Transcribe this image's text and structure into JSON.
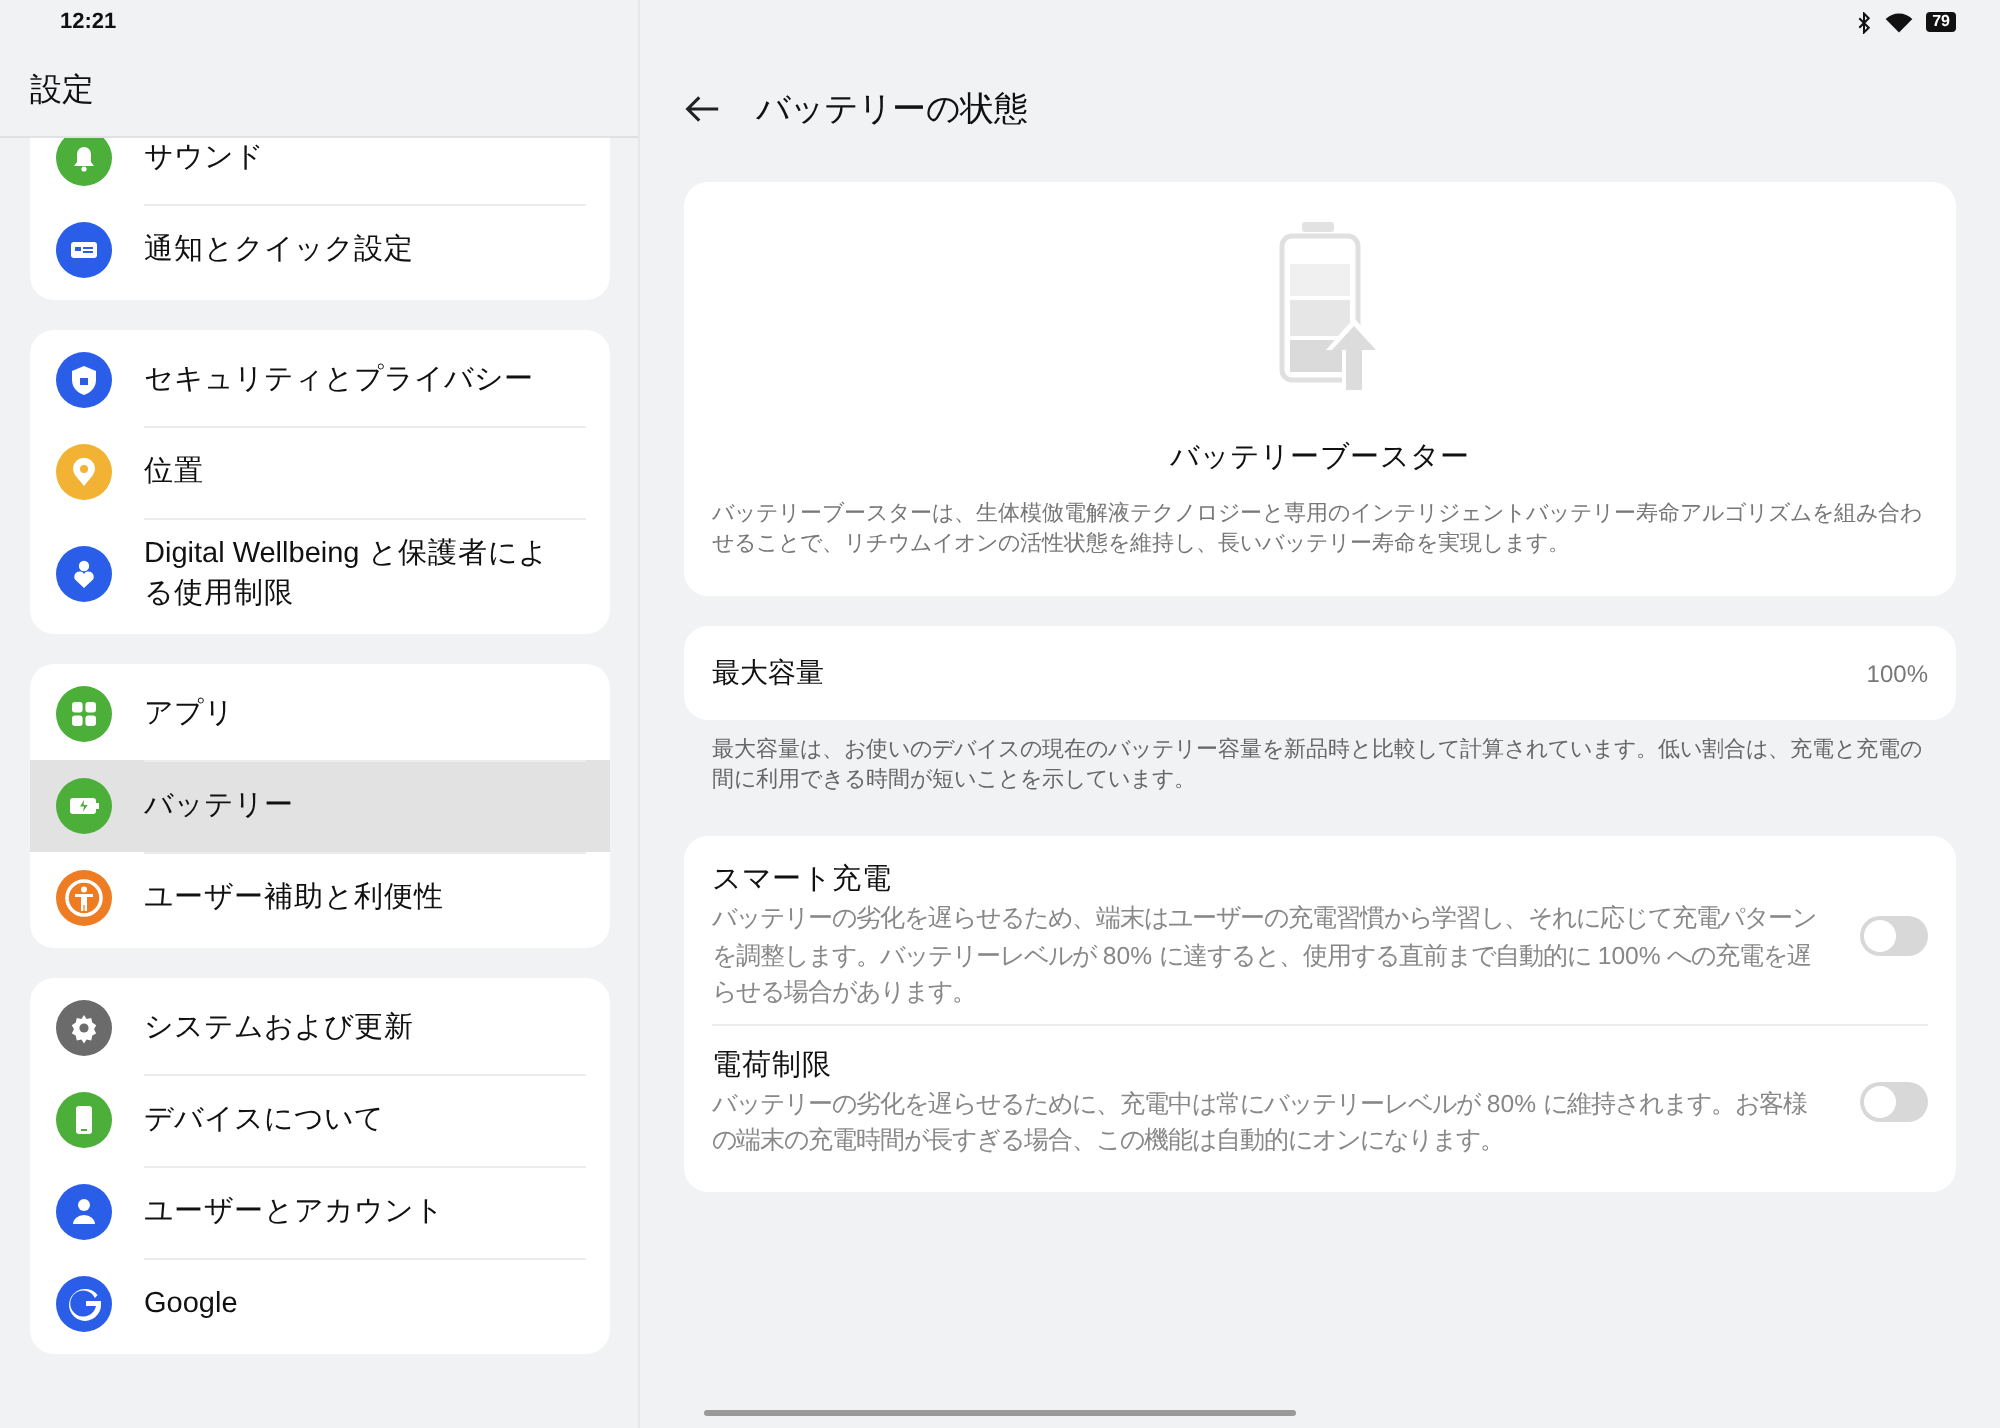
{
  "status_bar": {
    "time": "12:21",
    "battery": "79"
  },
  "sidebar": {
    "title": "設定",
    "groups": [
      {
        "items": [
          {
            "label": "サウンド",
            "color": "#4caf3a",
            "selected": false
          },
          {
            "label": "通知とクイック設定",
            "color": "#2a5ee8",
            "selected": false
          }
        ]
      },
      {
        "items": [
          {
            "label": "セキュリティとプライバシー",
            "color": "#2a5ee8",
            "selected": false
          },
          {
            "label": "位置",
            "color": "#f2b233",
            "selected": false
          },
          {
            "label": "Digital Wellbeing と保護者による使用制限",
            "color": "#2a5ee8",
            "selected": false
          }
        ]
      },
      {
        "items": [
          {
            "label": "アプリ",
            "color": "#4caf3a",
            "selected": false
          },
          {
            "label": "バッテリー",
            "color": "#4caf3a",
            "selected": true
          },
          {
            "label": "ユーザー補助と利便性",
            "color": "#ee7c22",
            "selected": false
          }
        ]
      },
      {
        "items": [
          {
            "label": "システムおよび更新",
            "color": "#6b6b6b",
            "selected": false
          },
          {
            "label": "デバイスについて",
            "color": "#4caf3a",
            "selected": false
          },
          {
            "label": "ユーザーとアカウント",
            "color": "#2a5ee8",
            "selected": false
          },
          {
            "label": "Google",
            "color": "#2a5ee8",
            "selected": false
          }
        ]
      }
    ]
  },
  "page": {
    "title": "バッテリーの状態",
    "booster": {
      "title": "バッテリーブースター",
      "description": "バッテリーブースターは、生体模倣電解液テクノロジーと専用のインテリジェントバッテリー寿命アルゴリズムを組み合わせることで、リチウムイオンの活性状態を維持し、長いバッテリー寿命を実現します。"
    },
    "capacity": {
      "label": "最大容量",
      "value": "100%",
      "note": "最大容量は、お使いのデバイスの現在のバッテリー容量を新品時と比較して計算されています。低い割合は、充電と充電の間に利用できる時間が短いことを示しています。"
    },
    "toggles": [
      {
        "title": "スマート充電",
        "description": "バッテリーの劣化を遅らせるため、端末はユーザーの充電習慣から学習し、それに応じて充電パターンを調整します。バッテリーレベルが 80% に達すると、使用する直前まで自動的に 100% への充電を遅らせる場合があります。",
        "on": false
      },
      {
        "title": "電荷制限",
        "description": "バッテリーの劣化を遅らせるために、充電中は常にバッテリーレベルが 80% に維持されます。お客様の端末の充電時間が長すぎる場合、この機能は自動的にオンになります。",
        "on": false
      }
    ]
  }
}
